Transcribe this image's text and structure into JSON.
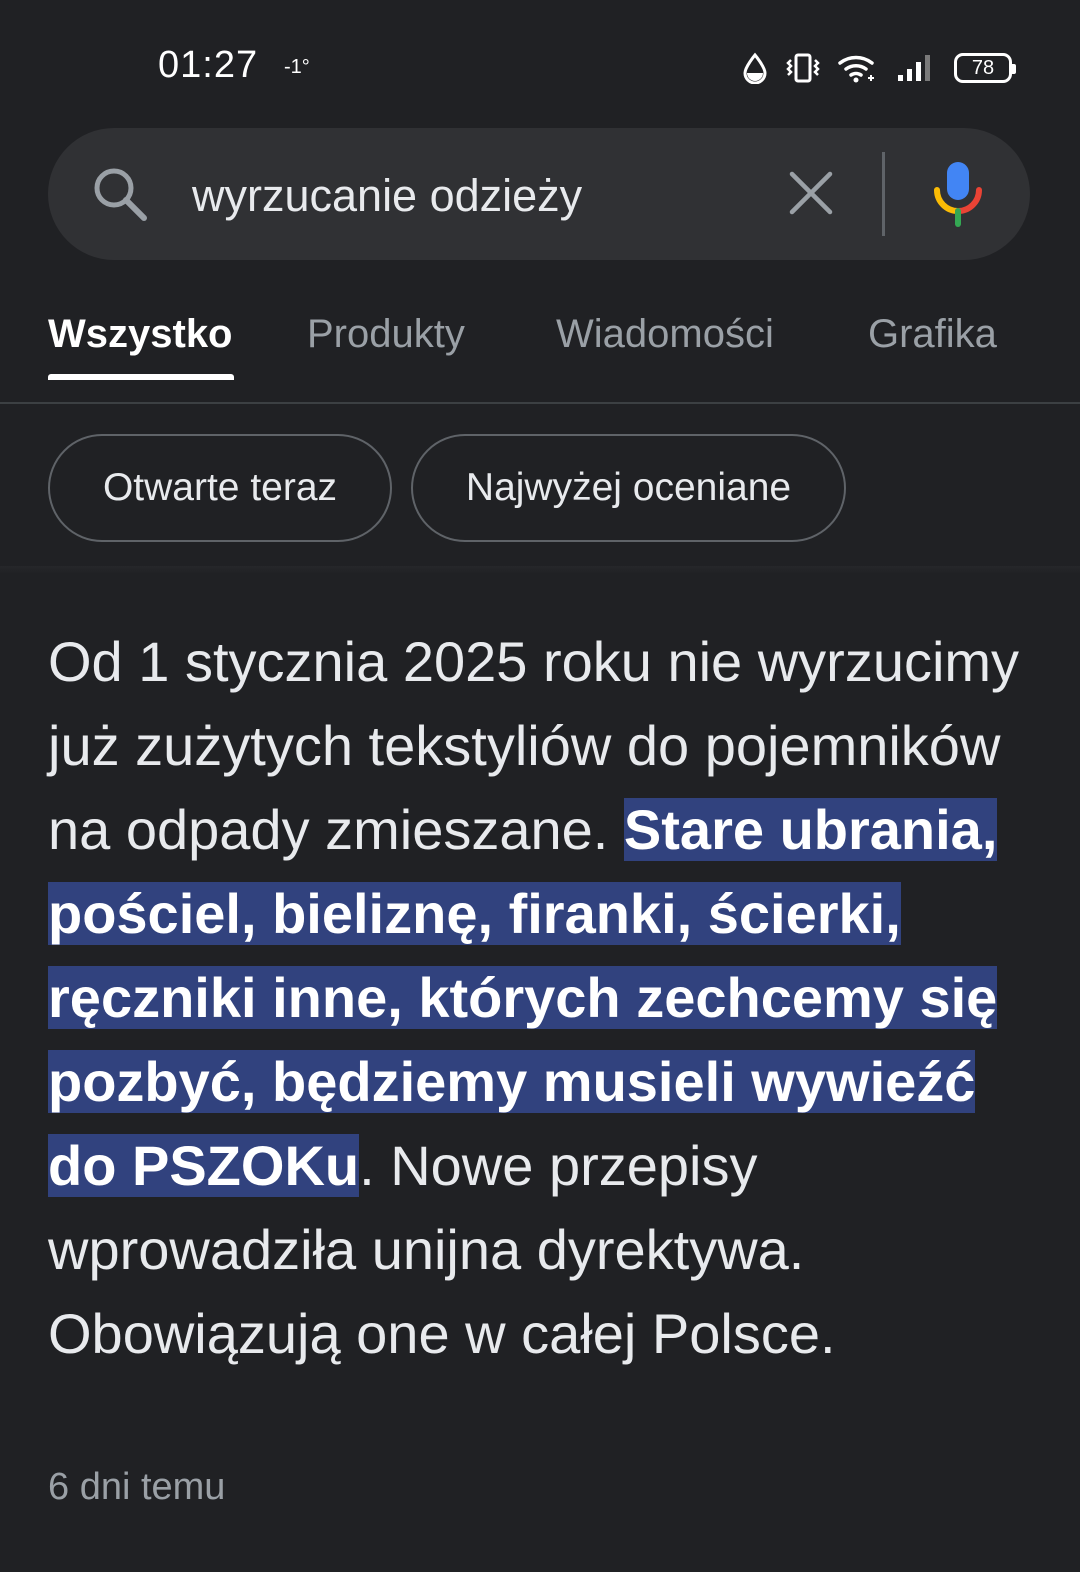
{
  "status_bar": {
    "time": "01:27",
    "temperature": "-1°",
    "battery": "78",
    "icons": [
      "drop-icon",
      "vibrate-icon",
      "wifi-icon",
      "signal-icon",
      "battery-icon"
    ]
  },
  "search": {
    "query": "wyrzucanie odzieży",
    "icons": [
      "search-icon",
      "close-icon",
      "mic-icon"
    ],
    "mic_colors": [
      "#4285f4",
      "#ea4335",
      "#fbbc05",
      "#34a853"
    ]
  },
  "tabs": [
    {
      "label": "Wszystko",
      "active": true
    },
    {
      "label": "Produkty",
      "active": false
    },
    {
      "label": "Wiadomości",
      "active": false
    },
    {
      "label": "Grafika",
      "active": false
    }
  ],
  "chips": [
    {
      "label": "Otwarte teraz"
    },
    {
      "label": "Najwyżej oceniane"
    }
  ],
  "snippet": {
    "text_before": "Od 1 stycznia 2025 roku nie wyrzucimy już zużytych tekstyliów do pojemników na odpady zmieszane. ",
    "highlighted": "Stare ubrania, pościel, bieliznę, firanki, ścierki, ręczniki inne, których zechcemy się pozbyć, będziemy musieli wywieźć do PSZOKu",
    "text_after": ". Nowe przepisy wprowadziła unijna dyrektywa. Obowiązują one w całej Polsce.",
    "date": "6 dni temu",
    "highlight_color": "#31427e"
  }
}
